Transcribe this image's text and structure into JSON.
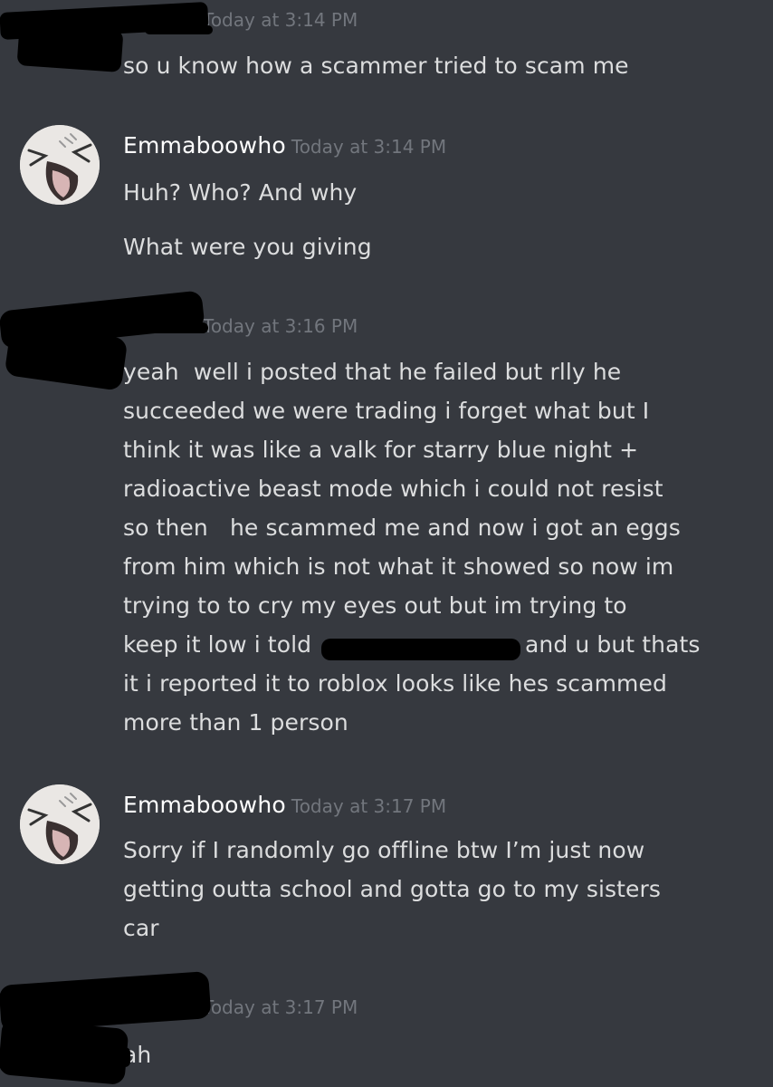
{
  "messages": [
    {
      "author": "",
      "timestamp": "Today at 3:14 PM",
      "lines": [
        "so u know how a scammer tried to scam me"
      ]
    },
    {
      "author": "Emmaboowho",
      "timestamp": "Today at 3:14 PM",
      "lines": [
        "Huh? Who? And why",
        "What were you giving"
      ]
    },
    {
      "author": "",
      "timestamp": "Today at 3:16 PM",
      "lines": [
        "yeah  well i posted that he failed but rlly he",
        "succeeded we were trading i forget what but I",
        "think it was like a valk for starry blue night +",
        "radioactive beast mode which i could not resist",
        "so then   he scammed me and now i got an eggs",
        "from him which is not what it showed so now im",
        "trying to to cry my eyes out but im trying to",
        "keep it low i told",
        "and u but thats",
        "it i reported it to roblox looks like hes scammed",
        "more than 1 person"
      ]
    },
    {
      "author": "Emmaboowho",
      "timestamp": "Today at 3:17 PM",
      "lines": [
        "Sorry if I randomly go offline btw I’m just now",
        "getting outta school and gotta go to my sisters",
        "car"
      ]
    },
    {
      "author": "",
      "timestamp": "Today at 3:17 PM",
      "lines": [
        "ah"
      ]
    }
  ],
  "icons": {
    "avatar": "emmaboowho-avatar-icon"
  },
  "colors": {
    "background": "#36393f",
    "username": "#ffffff",
    "timestamp": "#72767d",
    "message_text": "#dcddde",
    "redaction": "#000000"
  }
}
